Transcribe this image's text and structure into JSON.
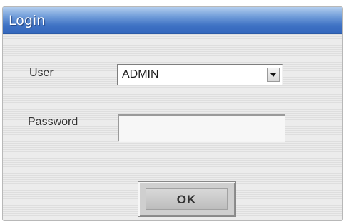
{
  "window": {
    "title": "Login"
  },
  "form": {
    "user_label": "User",
    "user_value": "ADMIN",
    "password_label": "Password",
    "password_value": ""
  },
  "buttons": {
    "ok_label": "OK"
  },
  "icons": {
    "dropdown": "chevron-down-icon"
  },
  "colors": {
    "titlebar": "#3f72c4",
    "window_bg": "#e6e6e6"
  }
}
